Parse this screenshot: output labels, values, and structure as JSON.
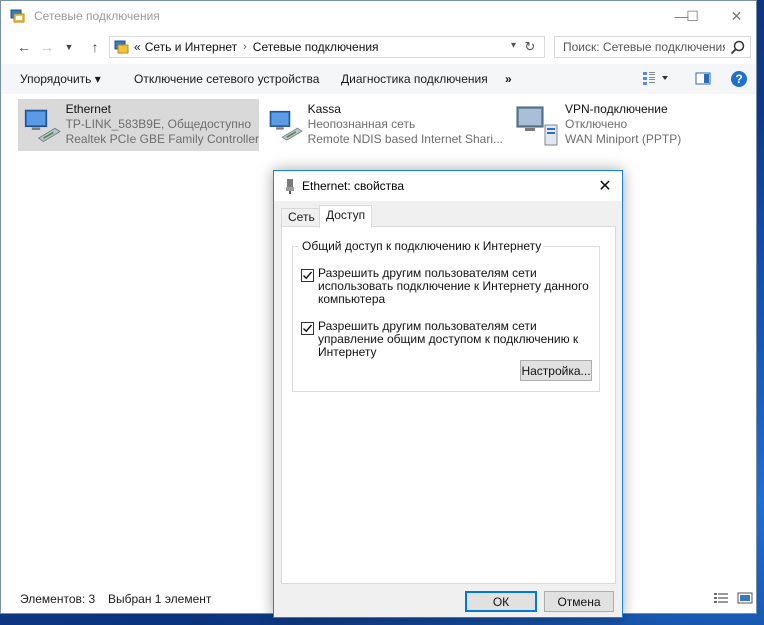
{
  "window": {
    "title": "Сетевые подключения",
    "controls": {
      "minimize": "—",
      "maximize": "☐",
      "close": "✕"
    }
  },
  "address_bar": {
    "overflow": "«",
    "crumbs": [
      "Сеть и Интернет",
      "Сетевые подключения"
    ],
    "separator": "›"
  },
  "search": {
    "placeholder": "Поиск: Сетевые подключения"
  },
  "toolbar": {
    "organize": "Упорядочить ▾",
    "disable": "Отключение сетевого устройства",
    "diagnose": "Диагностика подключения",
    "more": "»"
  },
  "connections": [
    {
      "name": "Ethernet",
      "line1": "TP-LINK_583B9E, Общедоступно",
      "line2": "Realtek PCIe GBE Family Controller",
      "selected": true
    },
    {
      "name": "Kassa",
      "line1": "Неопознанная сеть",
      "line2": "Remote NDIS based Internet Shari...",
      "selected": false
    },
    {
      "name": "VPN-подключение",
      "line1": "Отключено",
      "line2": "WAN Miniport (PPTP)",
      "selected": false
    }
  ],
  "status": {
    "count": "Элементов: 3",
    "selected": "Выбран 1 элемент"
  },
  "dialog": {
    "title": "Ethernet: свойства",
    "close": "✕",
    "tabs": [
      "Сеть",
      "Доступ"
    ],
    "active_tab": "Доступ",
    "group_title": "Общий доступ к подключению к Интернету",
    "checkbox1": "Разрешить другим пользователям сети использовать подключение к Интернету данного компьютера",
    "checkbox1_checked": true,
    "checkbox2": "Разрешить другим пользователям сети управление общим доступом к подключению к Интернету",
    "checkbox2_checked": true,
    "settings_button": "Настройка...",
    "ok_button": "ОК",
    "cancel_button": "Отмена"
  },
  "colors": {
    "accent": "#0078d7",
    "selection": "#d9d9d9",
    "help": "#1e6fd0"
  }
}
